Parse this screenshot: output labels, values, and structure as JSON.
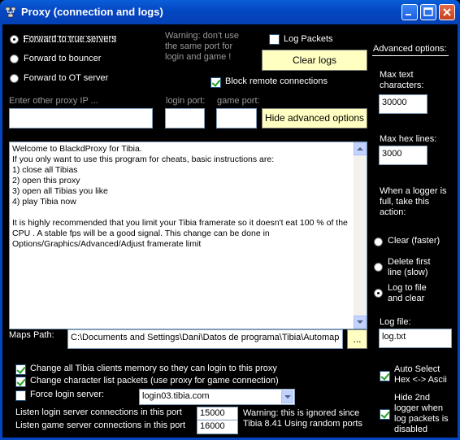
{
  "window": {
    "title": "Proxy (connection and logs)"
  },
  "routing": {
    "forward_true": "Forward to true servers",
    "forward_bouncer": "Forward to bouncer",
    "forward_ot": "Forward to OT server"
  },
  "warning_ports": "Warning: don't use\nthe same port for\nlogin and game !",
  "log_packets_label": "Log Packets",
  "clear_logs_label": "Clear logs",
  "block_remote_label": "Block remote connections",
  "proxy_ip_placeholder": "Enter other proxy IP ...",
  "login_port_label": "login port:",
  "game_port_label": "game port:",
  "hide_advanced_label": "Hide advanced options",
  "log_text": "Welcome to BlackdProxy for Tibia.\nIf you only want to use this program for cheats, basic instructions are:\n1) close all Tibias\n2) open this proxy\n3) open all Tibias you like\n4) play Tibia now\n\nIt is highly recommended that you limit your Tibia framerate so it doesn't eat 100 % of the CPU . A stable fps will be a good signal. This change can be done in Options/Graphics/Advanced/Adjust framerate limit",
  "maps_path_label": "Maps Path:",
  "maps_path_value": "C:\\Documents and Settings\\Dani\\Datos de programa\\Tibia\\Automap",
  "browse_label": "...",
  "change_memory_label": "Change all Tibia clients memory so they can login to this proxy",
  "change_charlist_label": "Change character list packets (use proxy for game connection)",
  "force_login_label": "Force login server:",
  "login_server_value": "login03.tibia.com",
  "listen_login_label": "Listen login server connections in this port",
  "listen_game_label": "Listen game server connections in this port",
  "listen_login_port": "15000",
  "listen_game_port": "16000",
  "port_warning": "Warning: this is ignored since\nTibia 8.41 Using random ports",
  "advanced": {
    "title": "Advanced options:",
    "max_text_label": "Max text\ncharacters:",
    "max_text_value": "30000",
    "max_hex_label": "Max hex lines:",
    "max_hex_value": "3000",
    "full_label": "When a logger is\nfull, take this\naction:",
    "clear_faster": "Clear (faster)",
    "delete_first": "Delete first\nline (slow)",
    "log_to_file": "Log to file\nand clear",
    "log_file_label": "Log file:",
    "log_file_value": "log.txt",
    "auto_select_label": "Auto Select\nHex <-> Ascii",
    "hide_2nd_label": "Hide 2nd\nlogger when\nlog packets is\ndisabled"
  },
  "colors": {
    "titlebar": "#0446c2",
    "button_bg": "#ffffc2",
    "background": "#000000"
  }
}
